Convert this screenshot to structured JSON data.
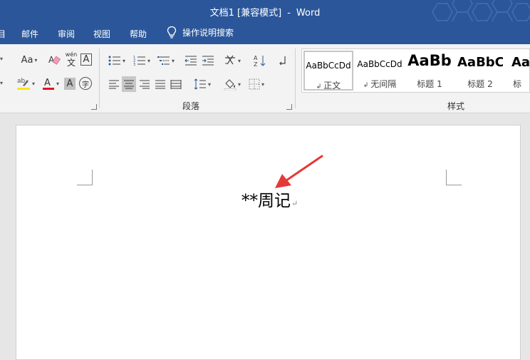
{
  "app": {
    "title": "文档1 [兼容模式]",
    "title_separator": "-",
    "app_name": "Word"
  },
  "menu_tabs": {
    "partial": "目",
    "mailings": "邮件",
    "review": "审阅",
    "view": "视图",
    "help": "帮助"
  },
  "tell_me": {
    "label": "操作说明搜索",
    "icon": "lightbulb-icon"
  },
  "ribbon": {
    "font": {
      "change_case": "Aa",
      "phonetic_top": "wén",
      "phonetic_bottom": "文",
      "char_border": "A",
      "font_color_letter": "A",
      "shading_letter": "A",
      "enclose_char": "字",
      "font_color_hex": "#e81123",
      "highlight_hex": "#f7e818"
    },
    "paragraph": {
      "label": "段落"
    },
    "styles": {
      "label": "样式",
      "items": [
        {
          "preview": "AaBbCcDd",
          "name": "正文",
          "mark": "↲"
        },
        {
          "preview": "AaBbCcDd",
          "name": "无间隔",
          "mark": "↲"
        },
        {
          "preview": "AaBb",
          "name": "标题 1",
          "mark": ""
        },
        {
          "preview": "AaBbC",
          "name": "标题 2",
          "mark": ""
        },
        {
          "preview": "Aa",
          "name": "标",
          "mark": ""
        }
      ]
    }
  },
  "document": {
    "text": "**周记",
    "paragraph_mark": "↵"
  },
  "colors": {
    "title_bar": "#2b579a",
    "ribbon_bg": "#f3f3f3",
    "annotation_arrow": "#e53935"
  }
}
